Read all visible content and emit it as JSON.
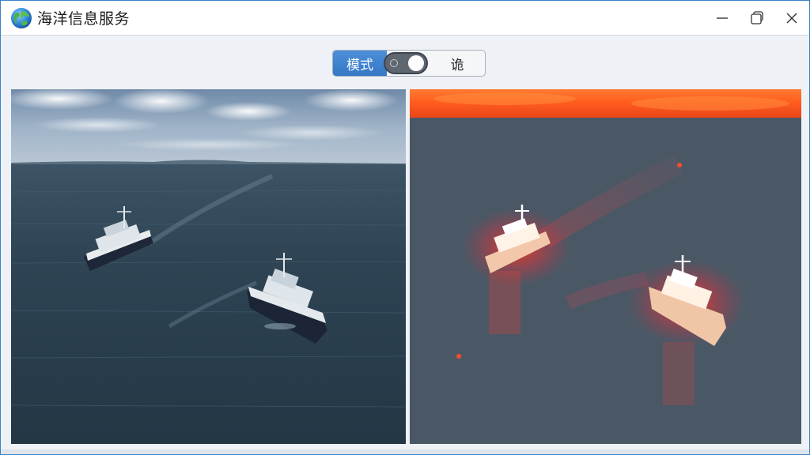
{
  "window": {
    "title": "海洋信息服务",
    "app_icon": "globe-icon",
    "controls": [
      "minimize-icon",
      "maximize-icon",
      "close-icon"
    ]
  },
  "toolbar": {
    "mode_label": "模式",
    "toggle_state": "on",
    "right_label": "诡"
  },
  "panels": {
    "left": {
      "kind": "photo",
      "subject": "two-ships-at-sea"
    },
    "right": {
      "kind": "heatmap",
      "subject": "two-ships-at-sea"
    }
  },
  "colors": {
    "accent": "#3a82c6",
    "sea_dark": "#2d3f4f",
    "heat_sea": "#4a5866",
    "heat_hot": "#ff3a1a"
  }
}
